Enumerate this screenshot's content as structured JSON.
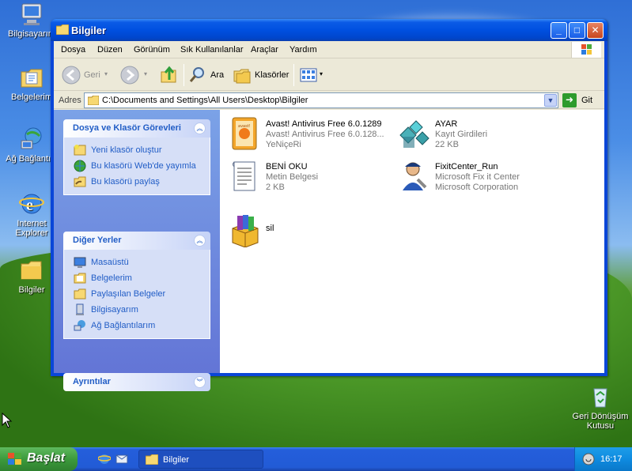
{
  "desktop": {
    "icons": [
      {
        "label": "Bilgisayarım",
        "icon": "my-computer-icon"
      },
      {
        "label": "Belgelerim",
        "icon": "my-documents-icon"
      },
      {
        "label": "Ağ Bağlantıla",
        "icon": "network-connections-icon"
      },
      {
        "label": "Internet Explorer",
        "icon": "internet-explorer-icon"
      },
      {
        "label": "Bilgiler",
        "icon": "folder-icon"
      },
      {
        "label": "Geri Dönüşüm Kutusu",
        "icon": "recycle-bin-icon"
      }
    ]
  },
  "window": {
    "title": "Bilgiler",
    "buttons": {
      "minimize": "_",
      "maximize": "□",
      "close": "✕"
    },
    "menu": [
      "Dosya",
      "Düzen",
      "Görünüm",
      "Sık Kullanılanlar",
      "Araçlar",
      "Yardım"
    ],
    "toolbar": {
      "back": "Geri",
      "forward": "",
      "search": "Ara",
      "folders": "Klasörler"
    },
    "address": {
      "label": "Adres",
      "value": "C:\\Documents and Settings\\All Users\\Desktop\\Bilgiler",
      "go": "Git"
    }
  },
  "taskpane": {
    "groups": [
      {
        "title": "Dosya ve Klasör Görevleri",
        "items": [
          "Yeni klasör oluştur",
          "Bu klasörü Web'de yayımla",
          "Bu klasörü paylaş"
        ]
      },
      {
        "title": "Diğer Yerler",
        "items": [
          "Masaüstü",
          "Belgelerim",
          "Paylaşılan Belgeler",
          "Bilgisayarım",
          "Ağ Bağlantılarım"
        ]
      },
      {
        "title": "Ayrıntılar",
        "items": []
      }
    ]
  },
  "files": [
    {
      "name": "Avast! Antivirus Free 6.0.1289",
      "line2": "Avast! Antivirus Free 6.0.128...",
      "line3": "YeNiçeRi",
      "icon": "avast-installer-icon"
    },
    {
      "name": "AYAR",
      "line2": "Kayıt Girdileri",
      "line3": "22 KB",
      "icon": "registry-file-icon"
    },
    {
      "name": "BENİ OKU",
      "line2": "Metin Belgesi",
      "line3": "2 KB",
      "icon": "text-document-icon"
    },
    {
      "name": "FixitCenter_Run",
      "line2": "Microsoft Fix it Center",
      "line3": "Microsoft Corporation",
      "icon": "fixit-center-icon"
    },
    {
      "name": "sil",
      "line2": "",
      "line3": "",
      "icon": "winrar-archive-icon"
    }
  ],
  "taskbar": {
    "start": "Başlat",
    "task": "Bilgiler",
    "clock": "16:17"
  },
  "colors": {
    "titlebar": "#0050e0",
    "taskpane_link": "#215dc6",
    "start_green": "#3c9a3c",
    "tray_blue": "#0f8be0"
  }
}
